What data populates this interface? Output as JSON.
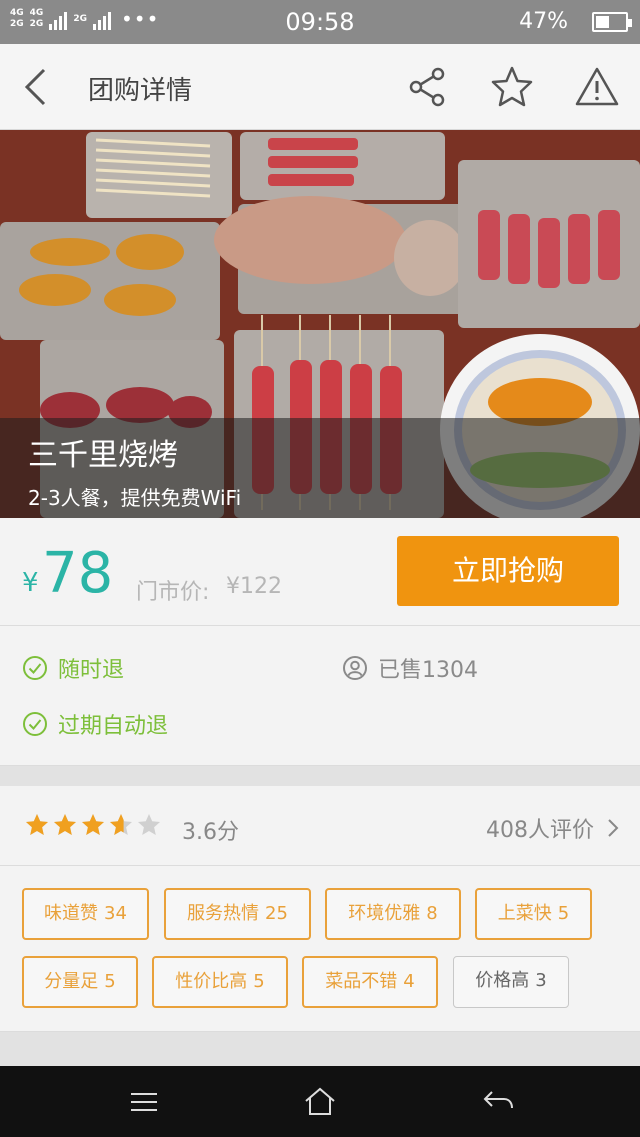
{
  "status_bar": {
    "net1": "4G",
    "net1b": "2G",
    "net2": "4G",
    "net2b": "2G",
    "net3": "2G",
    "time": "09:58",
    "battery_percent": "47%",
    "battery_level": 0.47
  },
  "header": {
    "title": "团购详情",
    "icons": [
      "back-icon",
      "share-icon",
      "star-icon",
      "warning-icon"
    ]
  },
  "hero": {
    "shop_name": "三千里烧烤",
    "description": "2-3人餐，提供免费WiFi"
  },
  "price": {
    "currency": "¥",
    "value": "78",
    "original_label": "门市价:",
    "original_price": "¥122",
    "buy_button": "立即抢购"
  },
  "guarantees": {
    "refund_anytime": "随时退",
    "refund_expired": "过期自动退",
    "sold": "已售1304"
  },
  "rating": {
    "stars": 3.6,
    "score": "3.6分",
    "reviews": "408人评价"
  },
  "tags": [
    {
      "label": "味道赞",
      "count": "34"
    },
    {
      "label": "服务热情",
      "count": "25"
    },
    {
      "label": "环境优雅",
      "count": "8"
    },
    {
      "label": "上菜快",
      "count": "5"
    },
    {
      "label": "分量足",
      "count": "5"
    },
    {
      "label": "性价比高",
      "count": "5"
    },
    {
      "label": "菜品不错",
      "count": "4"
    },
    {
      "label": "价格高",
      "count": "3"
    }
  ],
  "colors": {
    "accent": "#2bb4a6",
    "buy": "#f0940f",
    "tag": "#e9a13a",
    "check": "#7dbf3a",
    "star": "#f0a020"
  },
  "navbar": {
    "icons": [
      "menu-icon",
      "home-icon",
      "back-arrow-icon"
    ]
  }
}
